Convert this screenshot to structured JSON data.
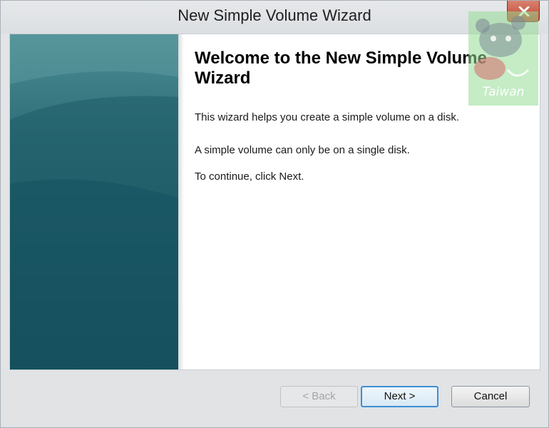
{
  "window": {
    "title": "New Simple Volume Wizard"
  },
  "content": {
    "heading": "Welcome to the New Simple Volume Wizard",
    "paragraphs": [
      "This wizard helps you create a simple volume on a disk.",
      "A simple volume can only be on a single disk.",
      "To continue, click Next."
    ]
  },
  "buttons": {
    "back": "< Back",
    "next": "Next >",
    "cancel": "Cancel"
  },
  "watermark": {
    "text": "Taiwan"
  },
  "icons": {
    "close": "close-icon",
    "watermark": "bear-mascot-icon"
  },
  "colors": {
    "banner_top": "#4d8e94",
    "banner_bottom": "#10434f",
    "close_button": "#c0432e",
    "default_button_border": "#3c8fd4"
  }
}
